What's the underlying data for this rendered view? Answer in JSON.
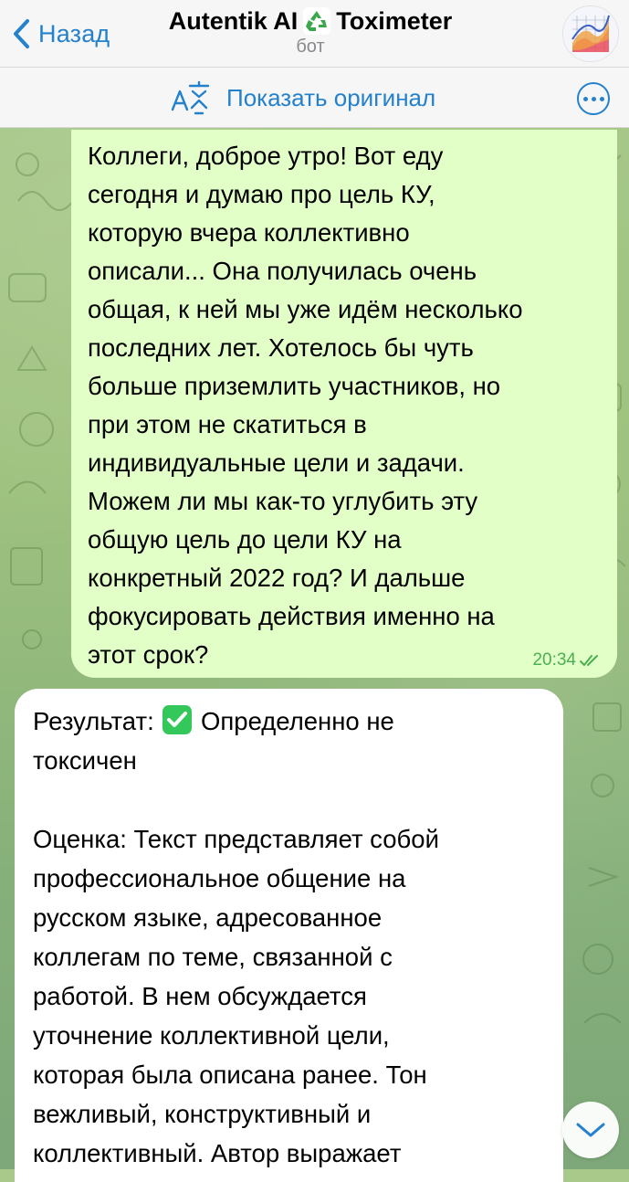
{
  "header": {
    "back_label": "Назад",
    "title_left": "Autentik AI",
    "title_right": "Toximeter",
    "subtitle": "бот",
    "title_icon": "recycle-icon",
    "avatar_icon": "chart-avatar-icon"
  },
  "translate_bar": {
    "label": "Показать оригинал",
    "icon": "translate-icon",
    "more_icon": "more-icon"
  },
  "messages": {
    "outgoing": {
      "text": "Коллеги, доброе утро! Вот еду\nсегодня и думаю про цель КУ,\nкоторую вчера коллективно\nописали... Она получилась очень\nобщая, к ней мы уже идём несколько\nпоследних лет. Хотелось бы чуть\nбольше приземлить участников, но\nпри этом не скатиться в\nиндивидуальные цели и задачи.\nМожем ли мы как-то углубить эту\nобщую цель до цели КУ на\nконкретный 2022 год? И дальше\nфокусировать действия именно на\nэтот срок?",
      "time": "20:34",
      "status_icon": "double-check-icon"
    },
    "incoming": {
      "result_prefix": "Результат:",
      "result_icon": "check-mark-emoji",
      "result_value": "Определенно не\nтоксичен",
      "body": "Оценка: Текст представляет собой\nпрофессиональное общение на\nрусском языке, адресованное\nколлегам по теме, связанной с\nработой. В нем обсуждается\nуточнение коллективной цели,\nкоторая была описана ранее. Тон\nвежливый, конструктивный и\nколлективный. Автор выражает"
    }
  },
  "colors": {
    "accent": "#2481cc",
    "outgoing_bubble": "#e2ffc8",
    "incoming_bubble": "#ffffff",
    "read_check": "#4caf50"
  }
}
